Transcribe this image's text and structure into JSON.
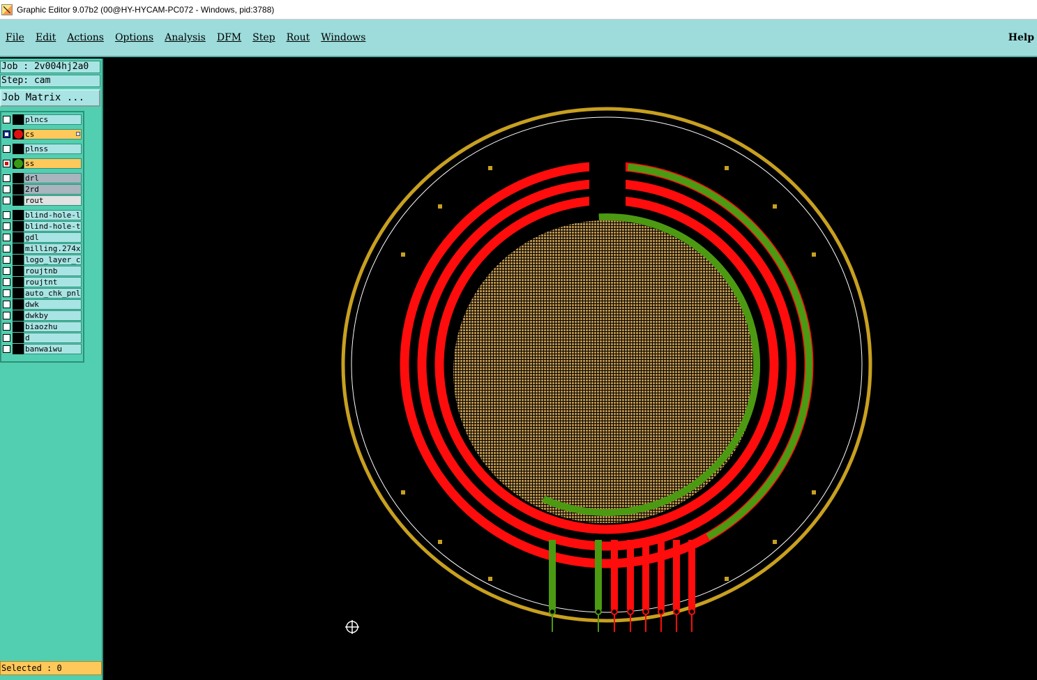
{
  "window": {
    "title": "Graphic Editor 9.07b2 (00@HY-HYCAM-PC072 - Windows, pid:3788)"
  },
  "menu": {
    "items": [
      "File",
      "Edit",
      "Actions",
      "Options",
      "Analysis",
      "DFM",
      "Step",
      "Rout",
      "Windows"
    ],
    "help": "Help"
  },
  "info": {
    "job": "Job : 2v004hj2a0",
    "step": "Step: cam",
    "job_matrix": "Job Matrix ..."
  },
  "layers": [
    {
      "name": "plncs",
      "state": "off",
      "color": null,
      "style": "normal"
    },
    {
      "name": "cs",
      "state": "work",
      "color": "#e01010",
      "style": "active"
    },
    {
      "name": "plnss",
      "state": "off",
      "color": null,
      "style": "normal"
    },
    {
      "name": "ss",
      "state": "on",
      "color": "#3a9a10",
      "style": "active"
    },
    {
      "name": "drl",
      "state": "off",
      "color": null,
      "style": "gray"
    },
    {
      "name": "2rd",
      "state": "off",
      "color": null,
      "style": "gray"
    },
    {
      "name": "rout",
      "state": "off",
      "color": null,
      "style": "light"
    },
    {
      "name": "blind-hole-l",
      "state": "off",
      "color": null,
      "style": "normal"
    },
    {
      "name": "blind-hole-t",
      "state": "off",
      "color": null,
      "style": "normal"
    },
    {
      "name": "gdl",
      "state": "off",
      "color": null,
      "style": "normal"
    },
    {
      "name": "milling.274x",
      "state": "off",
      "color": null,
      "style": "normal"
    },
    {
      "name": "logo_layer_c",
      "state": "off",
      "color": null,
      "style": "normal"
    },
    {
      "name": "roujtnb",
      "state": "off",
      "color": null,
      "style": "normal"
    },
    {
      "name": "roujtnt",
      "state": "off",
      "color": null,
      "style": "normal"
    },
    {
      "name": "auto_chk_pnl",
      "state": "off",
      "color": null,
      "style": "normal"
    },
    {
      "name": "dwk",
      "state": "off",
      "color": null,
      "style": "normal"
    },
    {
      "name": "dwkby",
      "state": "off",
      "color": null,
      "style": "normal"
    },
    {
      "name": "biaozhu",
      "state": "off",
      "color": null,
      "style": "normal"
    },
    {
      "name": "d",
      "state": "off",
      "color": null,
      "style": "normal"
    },
    {
      "name": "banwaiwu",
      "state": "off",
      "color": null,
      "style": "normal"
    }
  ],
  "status": {
    "selected": "Selected : 0"
  },
  "colors": {
    "menubar": "#9edcdc",
    "panel": "#52cfb0",
    "active_layer": "#ffc85a",
    "trace_red": "#ff0c0c",
    "trace_green": "#4c9a12",
    "outline_gold": "#c8a020",
    "pad_fill": "#b8904a"
  },
  "icons": {
    "app": "graphic-editor-icon",
    "cursor": "crosshair-cursor-icon"
  }
}
